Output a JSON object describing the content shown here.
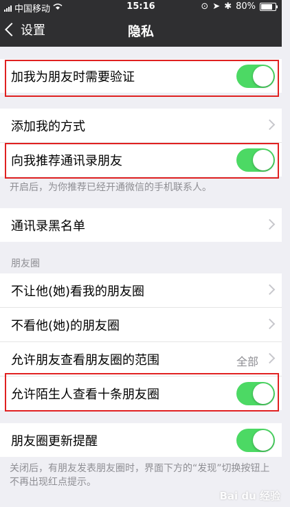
{
  "status_bar": {
    "carrier": "中国移动",
    "time": "15:16",
    "battery": "80%",
    "battery_level": 0.8
  },
  "nav": {
    "back_label": "设置",
    "title": "隐私"
  },
  "sections": {
    "verify": {
      "label": "加我为朋友时需要验证",
      "toggle_on": true
    },
    "add_methods": {
      "label": "添加我的方式"
    },
    "recommend": {
      "label": "向我推荐通讯录朋友",
      "toggle_on": true,
      "hint": "开启后，为你推荐已经开通微信的手机联系人。"
    },
    "blacklist": {
      "label": "通讯录黑名单"
    },
    "moments_header": "朋友圈",
    "moments": [
      {
        "label": "不让他(她)看我的朋友圈"
      },
      {
        "label": "不看他(她)的朋友圈"
      },
      {
        "label": "允许朋友查看朋友圈的范围",
        "value": "全部"
      },
      {
        "label": "允许陌生人查看十条朋友圈",
        "toggle_on": true
      }
    ],
    "moments_reminder": {
      "label": "朋友圈更新提醒",
      "toggle_on": true,
      "hint": "关闭后，有朋友发表朋友圈时，界面下方的“发现”切换按钮上不再出现红点提示。"
    }
  },
  "watermark": "Bai du 经验",
  "colors": {
    "toggle_on": "#4cd964",
    "highlight_box": "#e02020",
    "nav_bg": "#2f2f31"
  }
}
